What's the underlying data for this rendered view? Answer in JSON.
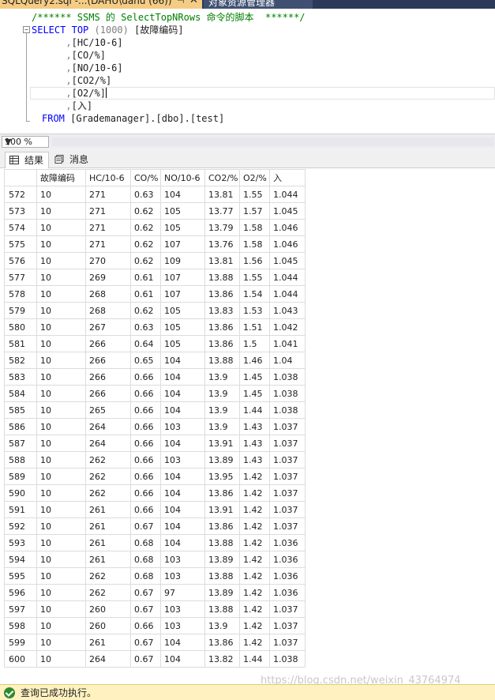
{
  "tabs": {
    "active_title": "SQLQuery2.sql -...(DAHU\\dahu (66))",
    "pin_glyph": "⊣",
    "close_glyph": "✕",
    "other_title": "对象资源管理器"
  },
  "editor": {
    "comment": "/****** SSMS 的 SelectTopNRows 命令的脚本  ******/",
    "select_kw": "SELECT",
    "top_kw": "TOP",
    "top_value": "(1000)",
    "first_col": "[故障编码]",
    "columns": [
      "[HC/10-6]",
      "[CO/%]",
      "[NO/10-6]",
      "[CO2/%]",
      "[O2/%]",
      "[入]"
    ],
    "from_kw": "FROM",
    "from_target": "[Grademanager].[dbo].[test]"
  },
  "zoom": {
    "value": "100 %"
  },
  "result_tabs": {
    "results": "结果",
    "messages": "消息"
  },
  "grid": {
    "headers": [
      "故障编码",
      "HC/10-6",
      "CO/%",
      "NO/10-6",
      "CO2/%",
      "O2/%",
      "入"
    ],
    "rows": [
      [
        "572",
        "10",
        "271",
        "0.63",
        "104",
        "13.81",
        "1.55",
        "1.044"
      ],
      [
        "573",
        "10",
        "271",
        "0.62",
        "105",
        "13.77",
        "1.57",
        "1.045"
      ],
      [
        "574",
        "10",
        "271",
        "0.62",
        "105",
        "13.79",
        "1.58",
        "1.046"
      ],
      [
        "575",
        "10",
        "271",
        "0.62",
        "107",
        "13.76",
        "1.58",
        "1.046"
      ],
      [
        "576",
        "10",
        "270",
        "0.62",
        "109",
        "13.81",
        "1.56",
        "1.045"
      ],
      [
        "577",
        "10",
        "269",
        "0.61",
        "107",
        "13.88",
        "1.55",
        "1.044"
      ],
      [
        "578",
        "10",
        "268",
        "0.61",
        "107",
        "13.86",
        "1.54",
        "1.044"
      ],
      [
        "579",
        "10",
        "268",
        "0.62",
        "105",
        "13.83",
        "1.53",
        "1.043"
      ],
      [
        "580",
        "10",
        "267",
        "0.63",
        "105",
        "13.86",
        "1.51",
        "1.042"
      ],
      [
        "581",
        "10",
        "266",
        "0.64",
        "105",
        "13.86",
        "1.5",
        "1.041"
      ],
      [
        "582",
        "10",
        "266",
        "0.65",
        "104",
        "13.88",
        "1.46",
        "1.04"
      ],
      [
        "583",
        "10",
        "266",
        "0.66",
        "104",
        "13.9",
        "1.45",
        "1.038"
      ],
      [
        "584",
        "10",
        "266",
        "0.66",
        "104",
        "13.9",
        "1.45",
        "1.038"
      ],
      [
        "585",
        "10",
        "265",
        "0.66",
        "104",
        "13.9",
        "1.44",
        "1.038"
      ],
      [
        "586",
        "10",
        "264",
        "0.66",
        "103",
        "13.9",
        "1.43",
        "1.037"
      ],
      [
        "587",
        "10",
        "264",
        "0.66",
        "104",
        "13.91",
        "1.43",
        "1.037"
      ],
      [
        "588",
        "10",
        "262",
        "0.66",
        "103",
        "13.89",
        "1.43",
        "1.037"
      ],
      [
        "589",
        "10",
        "262",
        "0.66",
        "104",
        "13.95",
        "1.42",
        "1.037"
      ],
      [
        "590",
        "10",
        "262",
        "0.66",
        "104",
        "13.86",
        "1.42",
        "1.037"
      ],
      [
        "591",
        "10",
        "261",
        "0.66",
        "104",
        "13.91",
        "1.42",
        "1.037"
      ],
      [
        "592",
        "10",
        "261",
        "0.67",
        "104",
        "13.86",
        "1.42",
        "1.037"
      ],
      [
        "593",
        "10",
        "261",
        "0.68",
        "104",
        "13.88",
        "1.42",
        "1.036"
      ],
      [
        "594",
        "10",
        "261",
        "0.68",
        "103",
        "13.89",
        "1.42",
        "1.036"
      ],
      [
        "595",
        "10",
        "262",
        "0.68",
        "103",
        "13.88",
        "1.42",
        "1.036"
      ],
      [
        "596",
        "10",
        "262",
        "0.67",
        "97",
        "13.89",
        "1.42",
        "1.036"
      ],
      [
        "597",
        "10",
        "260",
        "0.67",
        "103",
        "13.88",
        "1.42",
        "1.037"
      ],
      [
        "598",
        "10",
        "260",
        "0.66",
        "103",
        "13.9",
        "1.42",
        "1.037"
      ],
      [
        "599",
        "10",
        "261",
        "0.67",
        "104",
        "13.86",
        "1.42",
        "1.037"
      ],
      [
        "600",
        "10",
        "264",
        "0.67",
        "104",
        "13.82",
        "1.44",
        "1.038"
      ]
    ]
  },
  "status": {
    "text": "查询已成功执行。"
  },
  "watermark": "https://blog.csdn.net/weixin_43764974"
}
